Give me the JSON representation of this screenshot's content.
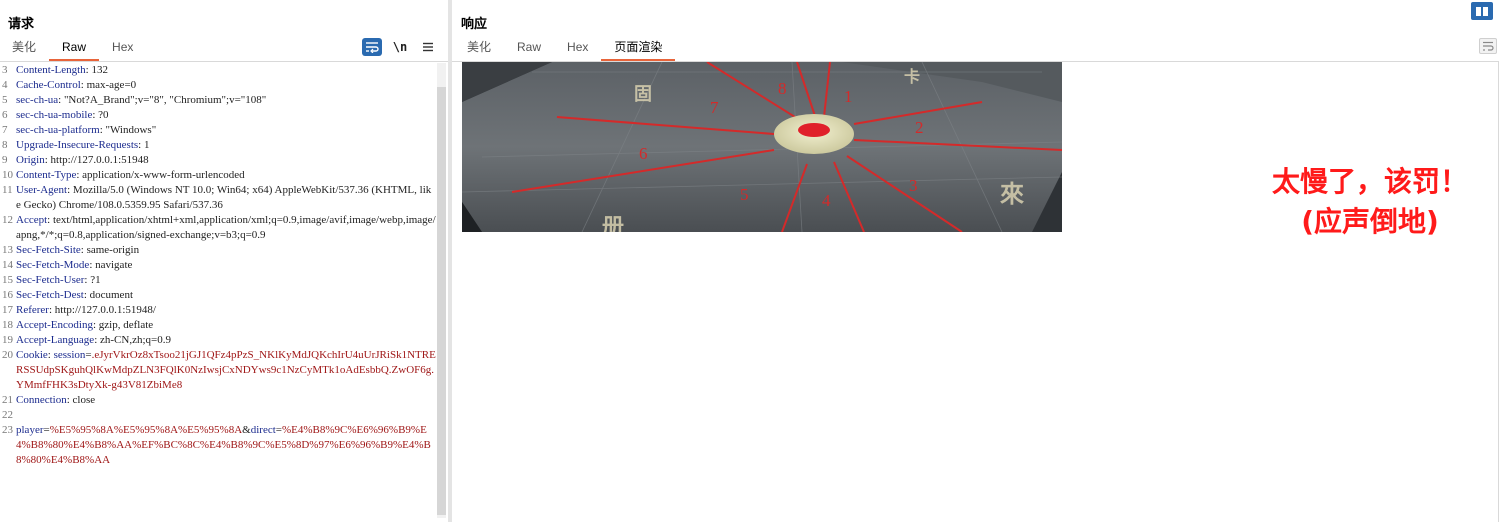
{
  "request": {
    "title": "请求",
    "tabs": [
      "美化",
      "Raw",
      "Hex"
    ],
    "active_tab": "Raw",
    "toolbar": {
      "newline_label": "\\n"
    },
    "lines": [
      {
        "n": "3",
        "segments": [
          [
            "k",
            "Content-Length"
          ],
          [
            "t",
            ": 132"
          ]
        ]
      },
      {
        "n": "4",
        "segments": [
          [
            "k",
            "Cache-Control"
          ],
          [
            "t",
            ": max-age=0"
          ]
        ]
      },
      {
        "n": "5",
        "segments": [
          [
            "k",
            "sec-ch-ua"
          ],
          [
            "t",
            ": \"Not?A_Brand\";v=\"8\", \"Chromium\";v=\"108\""
          ]
        ]
      },
      {
        "n": "6",
        "segments": [
          [
            "k",
            "sec-ch-ua-mobile"
          ],
          [
            "t",
            ": ?0"
          ]
        ]
      },
      {
        "n": "7",
        "segments": [
          [
            "k",
            "sec-ch-ua-platform"
          ],
          [
            "t",
            ": \"Windows\""
          ]
        ]
      },
      {
        "n": "8",
        "segments": [
          [
            "k",
            "Upgrade-Insecure-Requests"
          ],
          [
            "t",
            ": 1"
          ]
        ]
      },
      {
        "n": "9",
        "segments": [
          [
            "k",
            "Origin"
          ],
          [
            "t",
            ": http://127.0.0.1:51948"
          ]
        ]
      },
      {
        "n": "10",
        "segments": [
          [
            "k",
            "Content-Type"
          ],
          [
            "t",
            ": application/x-www-form-urlencoded"
          ]
        ]
      },
      {
        "n": "11",
        "segments": [
          [
            "k",
            "User-Agent"
          ],
          [
            "t",
            ": Mozilla/5.0 (Windows NT 10.0; Win64; x64) AppleWebKit/537.36 (KHTML, like Gecko) Chrome/108.0.5359.95 Safari/537.36"
          ]
        ]
      },
      {
        "n": "12",
        "segments": [
          [
            "k",
            "Accept"
          ],
          [
            "t",
            ": text/html,application/xhtml+xml,application/xml;q=0.9,image/avif,image/webp,image/apng,*/*;q=0.8,application/signed-exchange;v=b3;q=0.9"
          ]
        ]
      },
      {
        "n": "13",
        "segments": [
          [
            "k",
            "Sec-Fetch-Site"
          ],
          [
            "t",
            ": same-origin"
          ]
        ]
      },
      {
        "n": "14",
        "segments": [
          [
            "k",
            "Sec-Fetch-Mode"
          ],
          [
            "t",
            ": navigate"
          ]
        ]
      },
      {
        "n": "15",
        "segments": [
          [
            "k",
            "Sec-Fetch-User"
          ],
          [
            "t",
            ": ?1"
          ]
        ]
      },
      {
        "n": "16",
        "segments": [
          [
            "k",
            "Sec-Fetch-Dest"
          ],
          [
            "t",
            ": document"
          ]
        ]
      },
      {
        "n": "17",
        "segments": [
          [
            "k",
            "Referer"
          ],
          [
            "t",
            ": http://127.0.0.1:51948/"
          ]
        ]
      },
      {
        "n": "18",
        "segments": [
          [
            "k",
            "Accept-Encoding"
          ],
          [
            "t",
            ": gzip, deflate"
          ]
        ]
      },
      {
        "n": "19",
        "segments": [
          [
            "k",
            "Accept-Language"
          ],
          [
            "t",
            ": zh-CN,zh;q=0.9"
          ]
        ]
      },
      {
        "n": "20",
        "segments": [
          [
            "k",
            "Cookie"
          ],
          [
            "t",
            ": "
          ],
          [
            "k",
            "session"
          ],
          [
            "t",
            "="
          ],
          [
            "c",
            ".eJyrVkrOz8xTsoo21jGJ1QFz4pPzS_NKlKyMdJQKchIrU4uUrJRiSk1NTRERSSUdpSKguhQlKwMdpZLN3FQlK0NzIwsjCxNDYws9c1NzCyMTk1oAdEsbbQ.ZwOF6g.YMmfFHK3sDtyXk-g43V81ZbiMe8"
          ]
        ]
      },
      {
        "n": "21",
        "segments": [
          [
            "k",
            "Connection"
          ],
          [
            "t",
            ": close"
          ]
        ]
      },
      {
        "n": "22",
        "segments": []
      },
      {
        "n": "23",
        "segments": [
          [
            "k",
            "player"
          ],
          [
            "t",
            "="
          ],
          [
            "c",
            "%E5%95%8A%E5%95%8A%E5%95%8A"
          ],
          [
            "t",
            "&"
          ],
          [
            "k",
            "direct"
          ],
          [
            "t",
            "="
          ],
          [
            "c",
            "%E4%B8%9C%E6%96%B9%E4%B8%80%E4%B8%AA%EF%BC%8C%E4%B8%9C%E5%8D%97%E6%96%B9%E4%B8%80%E4%B8%AA"
          ]
        ]
      }
    ]
  },
  "response": {
    "title": "响应",
    "tabs": [
      "美化",
      "Raw",
      "Hex",
      "页面渲染"
    ],
    "active_tab": "页面渲染",
    "image": {
      "direction_labels": [
        "1",
        "2",
        "3",
        "4",
        "5",
        "6",
        "7",
        "8"
      ]
    },
    "caption_line1": "太慢了，该罚！",
    "caption_line2": "(应声倒地)"
  },
  "colors": {
    "accent_tab": "#e8643a",
    "key_blue": "#1b2b8e",
    "value_red": "#a01818",
    "caption_red": "#ff1a1a",
    "toolbar_blue": "#2a6ab0"
  },
  "icons": [
    "wrap-lines-icon",
    "newline-icon",
    "menu-icon",
    "layout-toggle-icon",
    "wrap-lines-icon"
  ]
}
